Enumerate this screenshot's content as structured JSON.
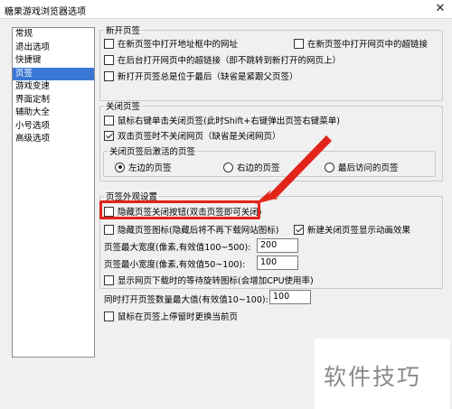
{
  "window": {
    "title": "糖果游戏浏览器选项"
  },
  "sidebar": {
    "items": [
      {
        "label": "常规"
      },
      {
        "label": "退出选项"
      },
      {
        "label": "快捷键"
      },
      {
        "label": "页签"
      },
      {
        "label": "游戏变速"
      },
      {
        "label": "界面定制"
      },
      {
        "label": "辅助大全"
      },
      {
        "label": "小号选项"
      },
      {
        "label": "高级选项"
      }
    ],
    "selected": "页签"
  },
  "new_tab": {
    "legend": "新开页签",
    "opt1": "在新页签中打开地址框中的网址",
    "opt2": "在新页签中打开网页中的超链接",
    "opt3": "在后台打开网页中的超链接（即不跳转到新打开的网页上）",
    "opt4": "新打开页签总是位于最后（缺省是紧跟父页签）"
  },
  "close_tab": {
    "legend": "关闭页签",
    "opt1": "鼠标右键单击关闭页签(此时Shift+右键弹出页签右键菜单)",
    "opt2": "双击页签时不关闭网页（缺省是关闭网页）",
    "activate": {
      "legend": "关闭页签后激活的页签",
      "left": "左边的页签",
      "right": "右边的页签",
      "last": "最后访问的页签"
    }
  },
  "appearance": {
    "legend": "页签外观设置",
    "hide_close_btn": "隐藏页签关闭按钮(双击页签即可关闭)",
    "hide_icon": "隐藏页签图标(隐藏后将不再下载网站图标)",
    "anim": "新建关闭页签显示动画效果",
    "max_width_label": "页签最大宽度(像素,有效值100~500):",
    "max_width_value": "200",
    "min_width_label": "页签最小宽度(像素,有效值50~100):",
    "min_width_value": "100",
    "spinner": "显示网页下载时的等待旋转图标(会增加CPU使用率)"
  },
  "misc": {
    "max_tabs_label": "同时打开页签数量最大值(有效值10~100):",
    "max_tabs_value": "100",
    "hover_switch": "鼠标在页签上停留时更换当前页"
  },
  "watermark": "软件技巧",
  "colors": {
    "selection": "#3b78d6",
    "highlight": "#e2231a"
  }
}
